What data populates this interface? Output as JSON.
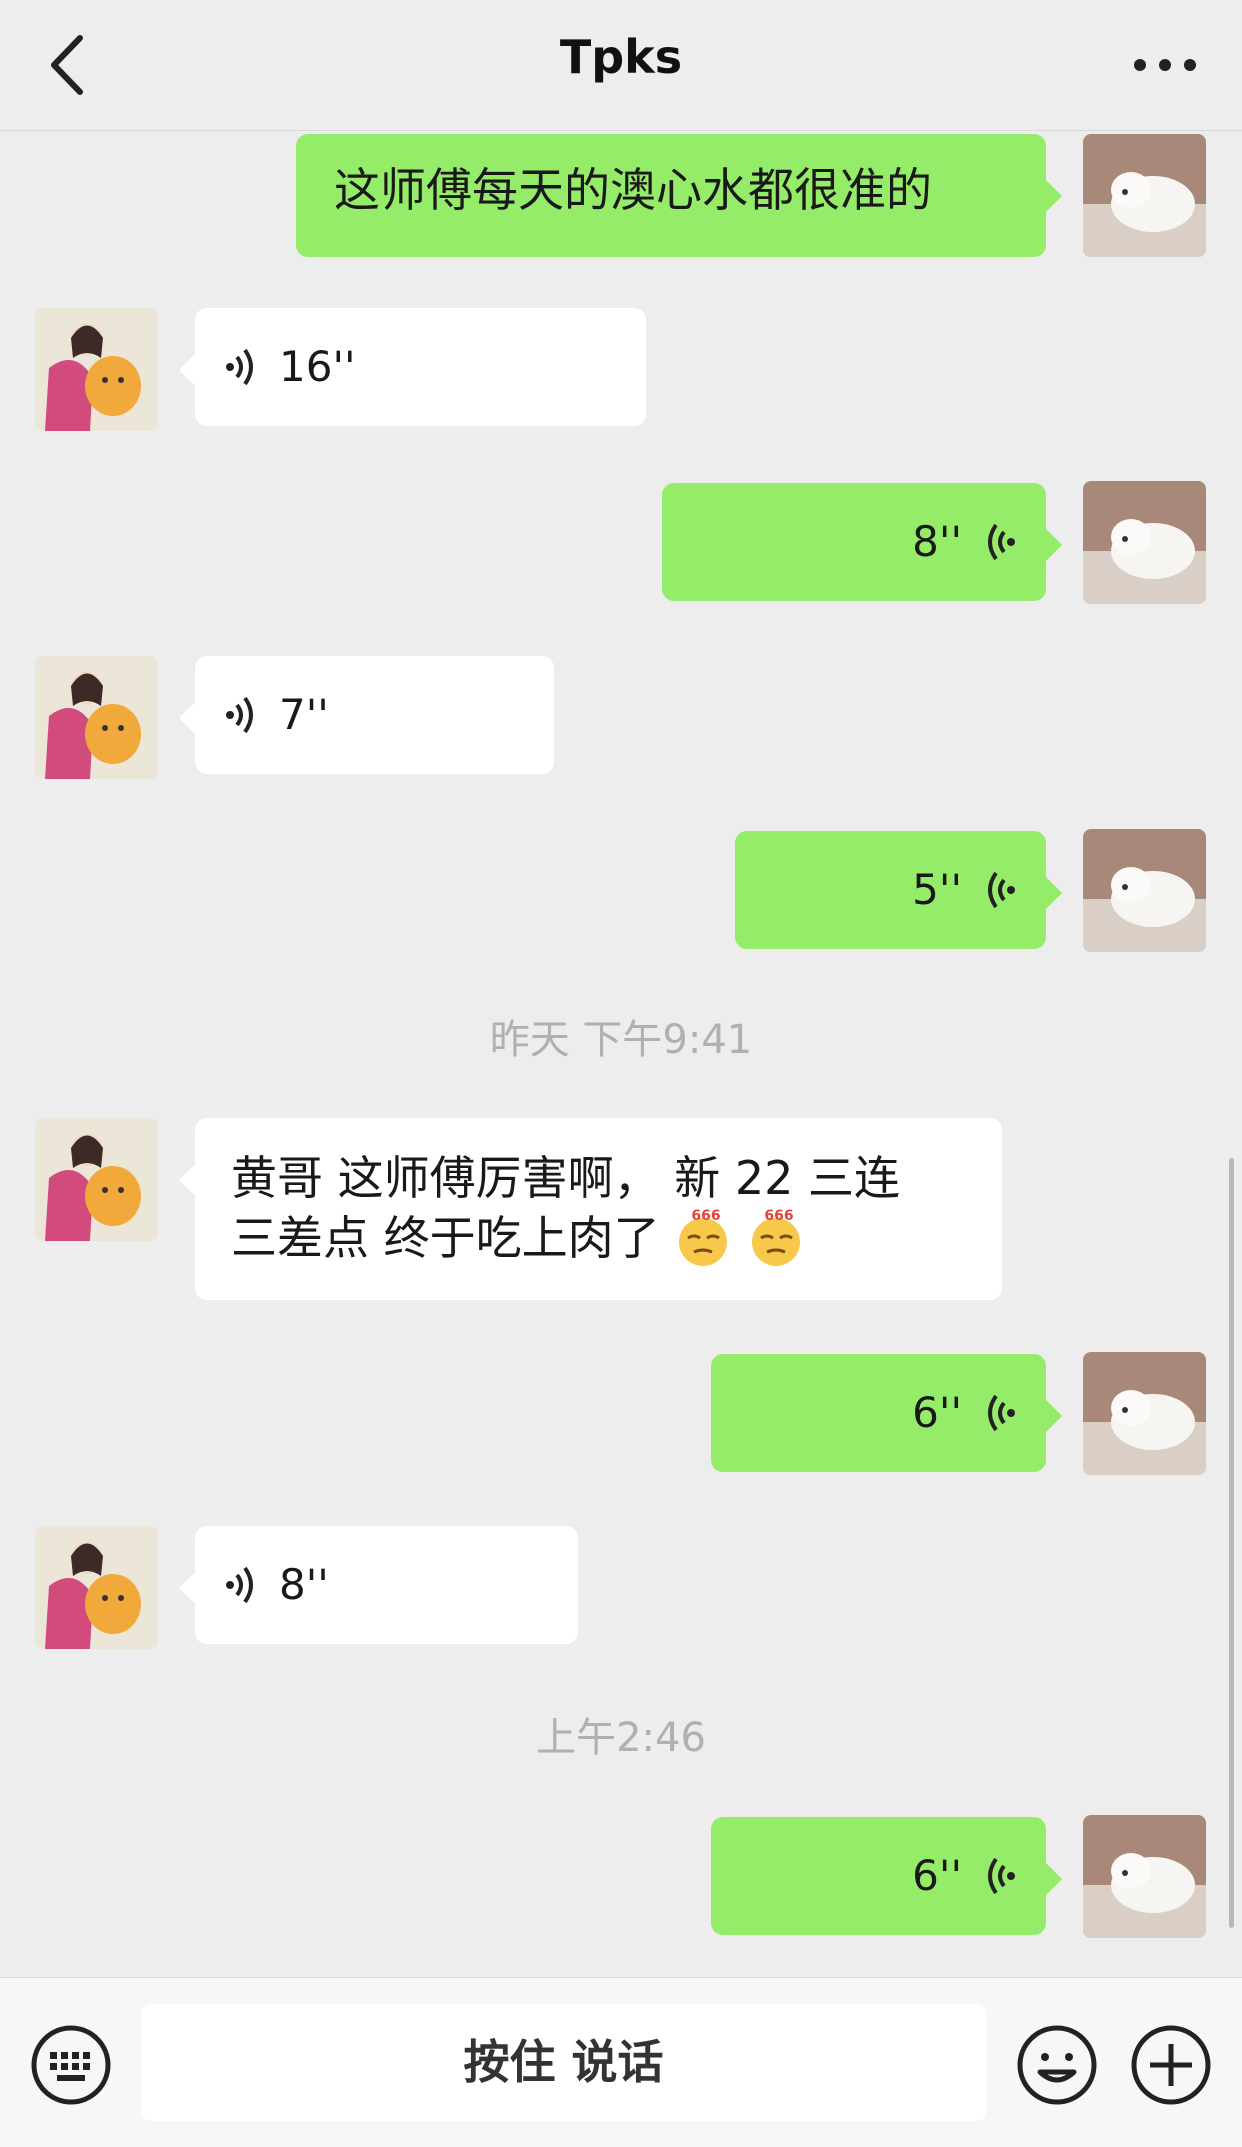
{
  "header": {
    "title": "Tpks"
  },
  "messages": [
    {
      "side": "out",
      "type": "text",
      "text": "这师傅每天的澳心水都很准的"
    },
    {
      "side": "in",
      "type": "voice",
      "duration": "16''"
    },
    {
      "side": "out",
      "type": "voice",
      "duration": "8''"
    },
    {
      "side": "in",
      "type": "voice",
      "duration": "7''"
    },
    {
      "side": "out",
      "type": "voice",
      "duration": "5''"
    },
    {
      "type": "timestamp",
      "text": "昨天 下午9:41"
    },
    {
      "side": "in",
      "type": "text",
      "line1": "黄哥 这师傅厉害啊， 新 22 三连",
      "line2": "三差点 终于吃上肉了",
      "emoji": "666-emoji",
      "emoji_label": "666"
    },
    {
      "side": "out",
      "type": "voice",
      "duration": "6''"
    },
    {
      "side": "in",
      "type": "voice",
      "duration": "8''"
    },
    {
      "type": "timestamp",
      "text": "上午2:46"
    },
    {
      "side": "out",
      "type": "voice",
      "duration": "6''"
    }
  ],
  "input_bar": {
    "talk_label": "按住 说话"
  },
  "icons": {
    "back": "chevron-left-icon",
    "more": "more-dots-icon",
    "keyboard": "keyboard-icon",
    "emoji": "smiley-icon",
    "plus": "plus-icon",
    "voice": "voice-wave-icon"
  },
  "colors": {
    "background": "#ededed",
    "outgoing_bubble": "#95ec69",
    "incoming_bubble": "#ffffff",
    "timestamp": "#b0b0b0"
  }
}
